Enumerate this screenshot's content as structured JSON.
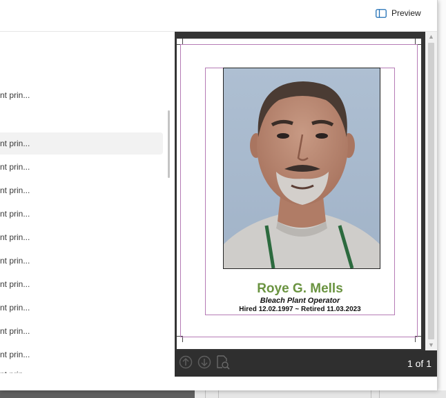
{
  "header": {
    "preview_label": "Preview"
  },
  "list": {
    "items": [
      {
        "label": "nt prin..."
      },
      {
        "label": "nt prin..."
      },
      {
        "label": "nt prin..."
      },
      {
        "label": "nt prin..."
      },
      {
        "label": "nt prin..."
      },
      {
        "label": "nt prin..."
      },
      {
        "label": "nt prin..."
      },
      {
        "label": "nt prin..."
      },
      {
        "label": "nt prin..."
      },
      {
        "label": "nt prin..."
      },
      {
        "label": "nt prin..."
      },
      {
        "label": "nt prin..."
      }
    ],
    "selected_index": 1
  },
  "document": {
    "name": "Roye G. Mells",
    "job_title": "Bleach Plant Operator",
    "dates": "Hired 12.02.1997 ~ Retired 11.03.2023",
    "name_color": "#6a9340",
    "guide_color": "#b57ab5"
  },
  "pager": {
    "counter": "1 of 1"
  },
  "icons": {
    "preview_toggle": "sidebar-panel-icon",
    "prev": "arrow-up-circle-icon",
    "next": "arrow-down-circle-icon",
    "page_search": "document-search-icon"
  }
}
